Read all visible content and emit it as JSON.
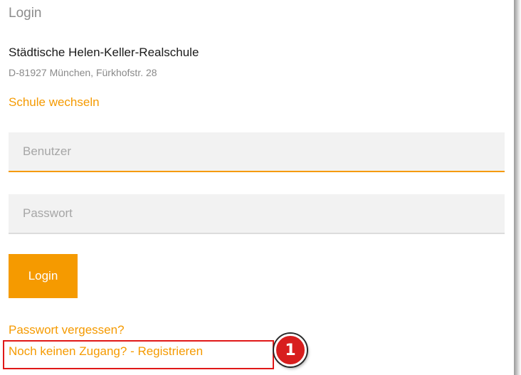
{
  "login": {
    "title": "Login",
    "school_name": "Städtische Helen-Keller-Realschule",
    "school_address": "D-81927 München, Fürkhofstr. 28",
    "change_school_link": "Schule wechseln",
    "username_placeholder": "Benutzer",
    "password_placeholder": "Passwort",
    "login_button": "Login",
    "forgot_password_link": "Passwort vergessen?",
    "register_link": "Noch keinen Zugang? - Registrieren"
  },
  "annotation": {
    "callout_number": "1",
    "highlight_color": "#e01818"
  },
  "theme": {
    "accent_color": "#f59a00"
  }
}
